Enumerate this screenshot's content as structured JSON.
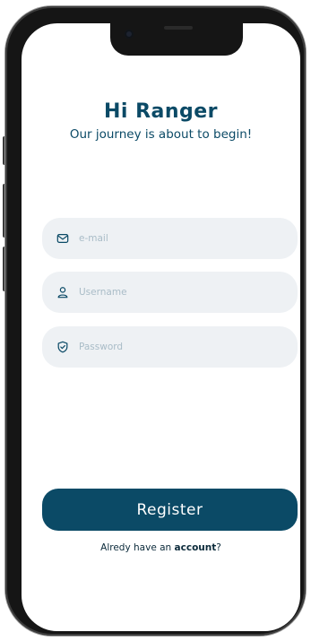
{
  "header": {
    "title": "Hi Ranger",
    "subtitle": "Our journey is about to begin!"
  },
  "form": {
    "email": {
      "placeholder": "e-mail",
      "icon": "mail-icon"
    },
    "username": {
      "placeholder": "Username",
      "icon": "user-icon"
    },
    "password": {
      "placeholder": "Password",
      "icon": "shield-check-icon"
    }
  },
  "actions": {
    "register_label": "Register"
  },
  "footer": {
    "prefix": "Alredy have an ",
    "link_label": "account",
    "suffix": "?"
  },
  "colors": {
    "primary": "#0b4a66",
    "field_bg": "#eef1f4",
    "placeholder": "#a9bcc7",
    "frame": "#151515"
  }
}
